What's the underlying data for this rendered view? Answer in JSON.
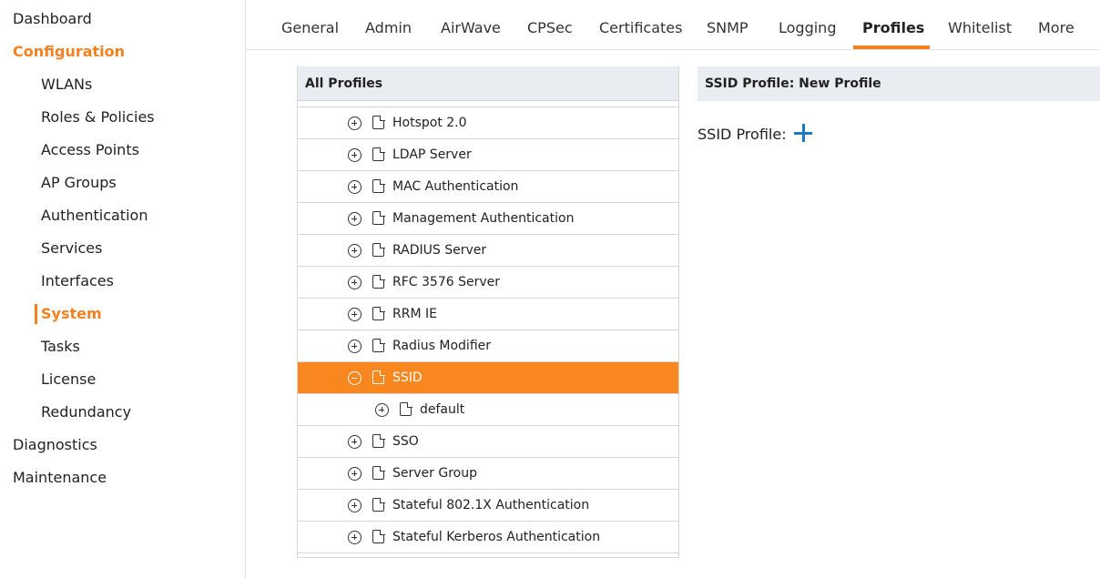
{
  "sidebar": {
    "items": [
      {
        "label": "Dashboard"
      },
      {
        "label": "Configuration"
      },
      {
        "label": "WLANs"
      },
      {
        "label": "Roles & Policies"
      },
      {
        "label": "Access Points"
      },
      {
        "label": "AP Groups"
      },
      {
        "label": "Authentication"
      },
      {
        "label": "Services"
      },
      {
        "label": "Interfaces"
      },
      {
        "label": "System"
      },
      {
        "label": "Tasks"
      },
      {
        "label": "License"
      },
      {
        "label": "Redundancy"
      },
      {
        "label": "Diagnostics"
      },
      {
        "label": "Maintenance"
      }
    ]
  },
  "tabs": [
    {
      "label": "General"
    },
    {
      "label": "Admin"
    },
    {
      "label": "AirWave"
    },
    {
      "label": "CPSec"
    },
    {
      "label": "Certificates"
    },
    {
      "label": "SNMP"
    },
    {
      "label": "Logging"
    },
    {
      "label": "Profiles"
    },
    {
      "label": "Whitelist"
    },
    {
      "label": "More"
    }
  ],
  "profiles_panel": {
    "title": "All Profiles",
    "rows": [
      {
        "label": "Hotspot 2.0"
      },
      {
        "label": "LDAP Server"
      },
      {
        "label": "MAC Authentication"
      },
      {
        "label": "Management Authentication"
      },
      {
        "label": "RADIUS Server"
      },
      {
        "label": "RFC 3576 Server"
      },
      {
        "label": "RRM IE"
      },
      {
        "label": "Radius Modifier"
      },
      {
        "label": "SSID"
      },
      {
        "label": "default"
      },
      {
        "label": "SSO"
      },
      {
        "label": "Server Group"
      },
      {
        "label": "Stateful 802.1X Authentication"
      },
      {
        "label": "Stateful Kerberos Authentication"
      }
    ]
  },
  "detail_panel": {
    "title": "SSID Profile: New Profile",
    "field_label": "SSID Profile:"
  },
  "colors": {
    "accent": "#f48120",
    "selected_row": "#f7871e",
    "add_icon": "#1a7dc4",
    "header_bg": "#e9ecf0"
  }
}
